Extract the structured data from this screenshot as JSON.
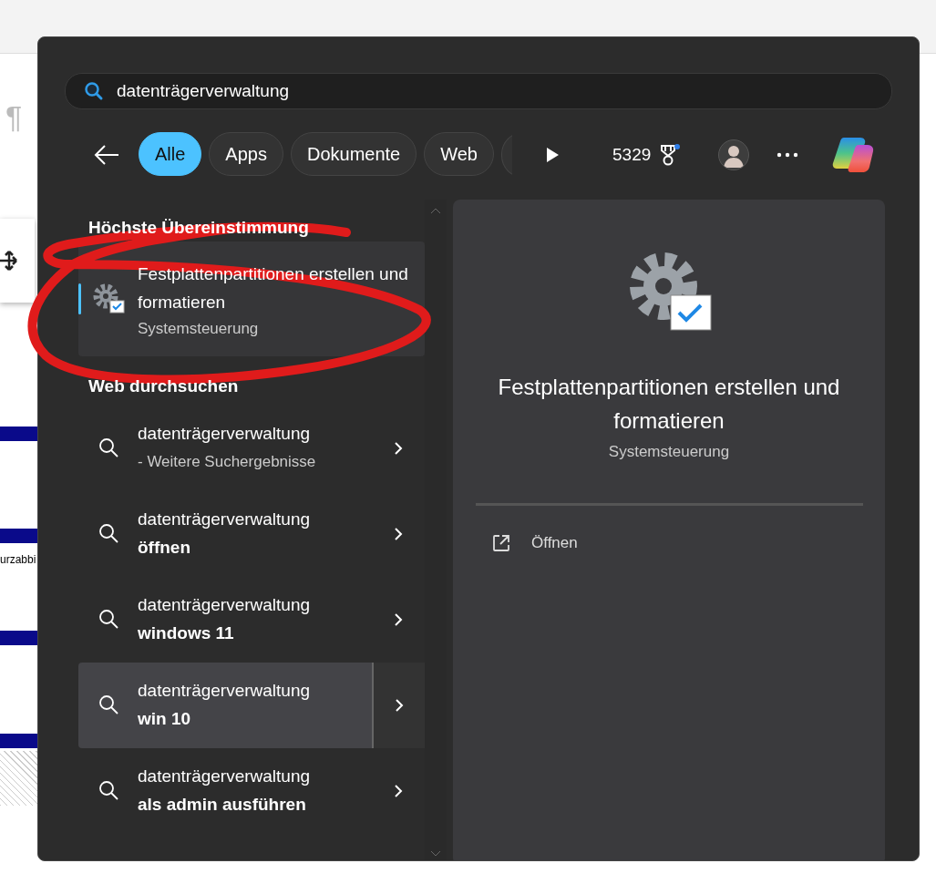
{
  "background_app": {
    "pilcrow": "¶",
    "fragment": "urzabbi"
  },
  "search": {
    "value": "datenträgerverwaltung"
  },
  "filters": [
    {
      "label": "Alle",
      "selected": true
    },
    {
      "label": "Apps",
      "selected": false
    },
    {
      "label": "Dokumente",
      "selected": false
    },
    {
      "label": "Web",
      "selected": false
    }
  ],
  "points": "5329",
  "best_match": {
    "heading": "Höchste Übereinstimmung",
    "title": "Festplattenpartitionen erstellen und formatieren",
    "subtitle": "Systemsteuerung",
    "selected": true
  },
  "web": {
    "heading": "Web durchsuchen",
    "items": [
      {
        "query": "datenträgerverwaltung",
        "suffix": "- Weitere Suchergebnisse",
        "kind": "more",
        "hovered": false
      },
      {
        "query": "datenträgerverwaltung",
        "suffix": "öffnen",
        "kind": "suggestion",
        "hovered": false
      },
      {
        "query": "datenträgerverwaltung",
        "suffix": "windows 11",
        "kind": "suggestion",
        "hovered": false
      },
      {
        "query": "datenträgerverwaltung",
        "suffix": "win 10",
        "kind": "suggestion",
        "hovered": true
      },
      {
        "query": "datenträgerverwaltung",
        "suffix": "als admin ausführen",
        "kind": "suggestion",
        "hovered": false
      }
    ]
  },
  "detail": {
    "title": "Festplattenpartitionen erstellen und formatieren",
    "subtitle": "Systemsteuerung",
    "actions": [
      {
        "label": "Öffnen"
      }
    ]
  }
}
